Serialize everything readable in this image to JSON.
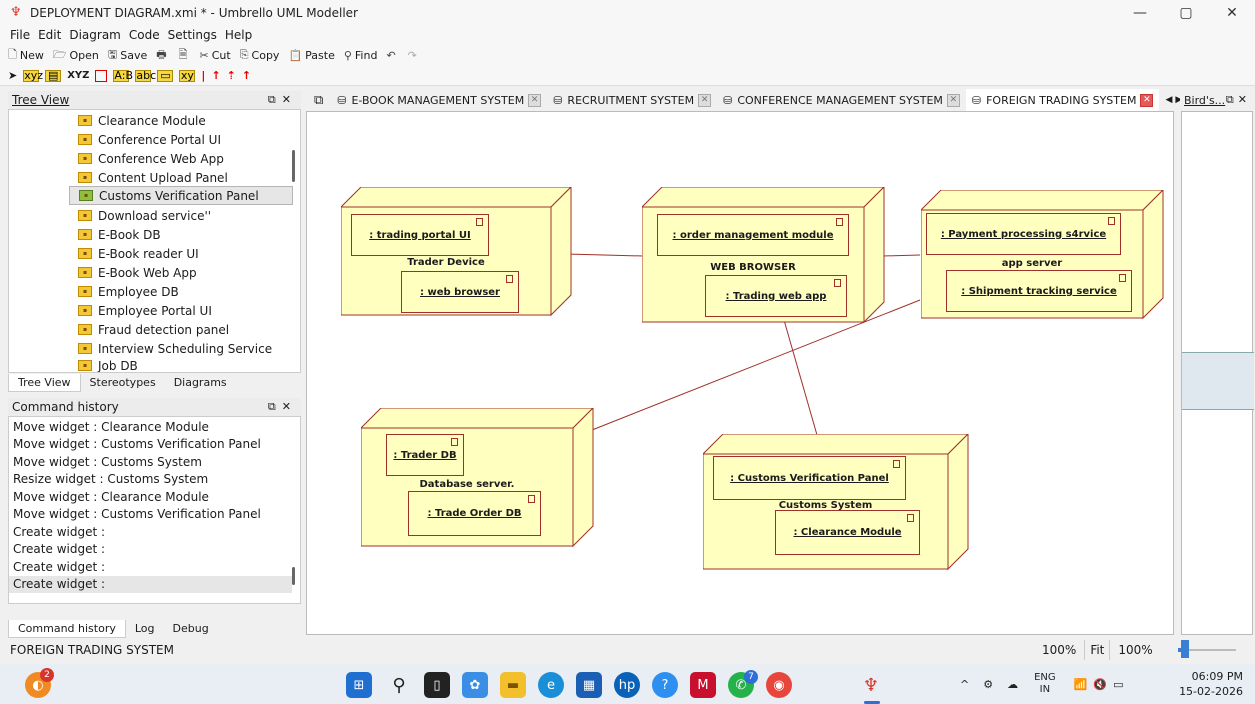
{
  "window": {
    "title": "DEPLOYMENT DIAGRAM.xmi * - Umbrello UML Modeller",
    "min": "—",
    "max": "▢",
    "close": "✕"
  },
  "menu": [
    "File",
    "Edit",
    "Diagram",
    "Code",
    "Settings",
    "Help"
  ],
  "toolbar": {
    "new": "New",
    "open": "Open",
    "save": "Save",
    "cut": "Cut",
    "copy": "Copy",
    "paste": "Paste",
    "find": "Find"
  },
  "tree_view": {
    "title": "Tree View",
    "items": [
      "Clearance Module",
      "Conference Portal UI",
      "Conference Web App",
      "Content Upload Panel",
      "Customs Verification Panel",
      "Download service''",
      "E-Book DB",
      "E-Book reader UI",
      "E-Book Web App",
      "Employee DB",
      "Employee Portal UI",
      "Fraud detection panel",
      "Interview Scheduling Service",
      "Job DB"
    ],
    "selected": "Customs Verification Panel",
    "tabs": [
      "Tree View",
      "Stereotypes",
      "Diagrams"
    ]
  },
  "command_history": {
    "title": "Command history",
    "items": [
      "Move widget : Clearance Module",
      "Move widget : Customs Verification Panel",
      "Move widget : Customs System",
      "Resize widget : Customs System",
      "Move widget : Clearance Module",
      "Move widget : Customs Verification Panel",
      "Create widget :",
      "Create widget :",
      "Create widget :",
      "Create widget :"
    ],
    "tabs": [
      "Command history",
      "Log",
      "Debug"
    ]
  },
  "diagram_tabs": [
    {
      "label": "E-BOOK MANAGEMENT SYSTEM",
      "active": false
    },
    {
      "label": "RECRUITMENT SYSTEM",
      "active": false
    },
    {
      "label": "CONFERENCE MANAGEMENT SYSTEM",
      "active": false
    },
    {
      "label": "FOREIGN TRADING SYSTEM",
      "active": true
    }
  ],
  "birds_eye": {
    "title": "Bird's..."
  },
  "diagram": {
    "nodes": [
      {
        "name": "Trader Device",
        "components": [
          ": trading portal UI",
          ": web browser"
        ]
      },
      {
        "name": "WEB BROWSER",
        "components": [
          ": order management module",
          ": Trading web app"
        ]
      },
      {
        "name": "app server",
        "components": [
          ": Payment processing s4rvice",
          ": Shipment tracking service"
        ]
      },
      {
        "name": "Database server.",
        "components": [
          ": Trader DB",
          ": Trade Order DB"
        ]
      },
      {
        "name": "Customs System",
        "components": [
          ": Customs Verification Panel",
          ": Clearance Module"
        ]
      }
    ]
  },
  "status": {
    "text": "FOREIGN TRADING SYSTEM",
    "zoom_left": "100%",
    "fit": "Fit",
    "zoom_right": "100%",
    "slider_fraction": 0.12
  },
  "taskbar": {
    "notify_count": "2",
    "whatsapp_count": "7",
    "lang": "ENG",
    "region": "IN",
    "time": "06:09 PM",
    "date": "15-02-2026"
  },
  "colors": {
    "node_fill": "#ffffc0",
    "node_border": "#a0302a",
    "active_tab_close": "#e45a5a",
    "accent": "#3b7fd4"
  }
}
